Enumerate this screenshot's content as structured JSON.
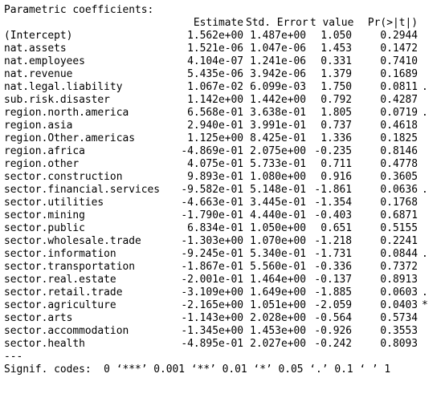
{
  "title": "Parametric coefficients:",
  "columns": {
    "estimate": "Estimate",
    "std_error": "Std. Error",
    "t_value": "t value",
    "p_value": "Pr(>|t|)"
  },
  "rows": [
    {
      "name": "(Intercept)",
      "estimate": "1.562e+00",
      "std_error": "1.487e+00",
      "t_value": "1.050",
      "p_value": "0.2944",
      "signif": ""
    },
    {
      "name": "nat.assets",
      "estimate": "1.521e-06",
      "std_error": "1.047e-06",
      "t_value": "1.453",
      "p_value": "0.1472",
      "signif": ""
    },
    {
      "name": "nat.employees",
      "estimate": "4.104e-07",
      "std_error": "1.241e-06",
      "t_value": "0.331",
      "p_value": "0.7410",
      "signif": ""
    },
    {
      "name": "nat.revenue",
      "estimate": "5.435e-06",
      "std_error": "3.942e-06",
      "t_value": "1.379",
      "p_value": "0.1689",
      "signif": ""
    },
    {
      "name": "nat.legal.liability",
      "estimate": "1.067e-02",
      "std_error": "6.099e-03",
      "t_value": "1.750",
      "p_value": "0.0811",
      "signif": "."
    },
    {
      "name": "sub.risk.disaster",
      "estimate": "1.142e+00",
      "std_error": "1.442e+00",
      "t_value": "0.792",
      "p_value": "0.4287",
      "signif": ""
    },
    {
      "name": "region.north.america",
      "estimate": "6.568e-01",
      "std_error": "3.638e-01",
      "t_value": "1.805",
      "p_value": "0.0719",
      "signif": "."
    },
    {
      "name": "region.asia",
      "estimate": "2.940e-01",
      "std_error": "3.991e-01",
      "t_value": "0.737",
      "p_value": "0.4618",
      "signif": ""
    },
    {
      "name": "region.Other.americas",
      "estimate": "1.125e+00",
      "std_error": "8.425e-01",
      "t_value": "1.336",
      "p_value": "0.1825",
      "signif": ""
    },
    {
      "name": "region.africa",
      "estimate": "-4.869e-01",
      "std_error": "2.075e+00",
      "t_value": "-0.235",
      "p_value": "0.8146",
      "signif": ""
    },
    {
      "name": "region.other",
      "estimate": "4.075e-01",
      "std_error": "5.733e-01",
      "t_value": "0.711",
      "p_value": "0.4778",
      "signif": ""
    },
    {
      "name": "sector.construction",
      "estimate": "9.893e-01",
      "std_error": "1.080e+00",
      "t_value": "0.916",
      "p_value": "0.3605",
      "signif": ""
    },
    {
      "name": "sector.financial.services",
      "estimate": "-9.582e-01",
      "std_error": "5.148e-01",
      "t_value": "-1.861",
      "p_value": "0.0636",
      "signif": "."
    },
    {
      "name": "sector.utilities",
      "estimate": "-4.663e-01",
      "std_error": "3.445e-01",
      "t_value": "-1.354",
      "p_value": "0.1768",
      "signif": ""
    },
    {
      "name": "sector.mining",
      "estimate": "-1.790e-01",
      "std_error": "4.440e-01",
      "t_value": "-0.403",
      "p_value": "0.6871",
      "signif": ""
    },
    {
      "name": "sector.public",
      "estimate": "6.834e-01",
      "std_error": "1.050e+00",
      "t_value": "0.651",
      "p_value": "0.5155",
      "signif": ""
    },
    {
      "name": "sector.wholesale.trade",
      "estimate": "-1.303e+00",
      "std_error": "1.070e+00",
      "t_value": "-1.218",
      "p_value": "0.2241",
      "signif": ""
    },
    {
      "name": "sector.information",
      "estimate": "-9.245e-01",
      "std_error": "5.340e-01",
      "t_value": "-1.731",
      "p_value": "0.0844",
      "signif": "."
    },
    {
      "name": "sector.transportation",
      "estimate": "-1.867e-01",
      "std_error": "5.560e-01",
      "t_value": "-0.336",
      "p_value": "0.7372",
      "signif": ""
    },
    {
      "name": "sector.real.estate",
      "estimate": "-2.001e-01",
      "std_error": "1.464e+00",
      "t_value": "-0.137",
      "p_value": "0.8913",
      "signif": ""
    },
    {
      "name": "sector.retail.trade",
      "estimate": "-3.109e+00",
      "std_error": "1.649e+00",
      "t_value": "-1.885",
      "p_value": "0.0603",
      "signif": "."
    },
    {
      "name": "sector.agriculture",
      "estimate": "-2.165e+00",
      "std_error": "1.051e+00",
      "t_value": "-2.059",
      "p_value": "0.0403",
      "signif": "*"
    },
    {
      "name": "sector.arts",
      "estimate": "-1.143e+00",
      "std_error": "2.028e+00",
      "t_value": "-0.564",
      "p_value": "0.5734",
      "signif": ""
    },
    {
      "name": "sector.accommodation",
      "estimate": "-1.345e+00",
      "std_error": "1.453e+00",
      "t_value": "-0.926",
      "p_value": "0.3553",
      "signif": ""
    },
    {
      "name": "sector.health",
      "estimate": "-4.895e-01",
      "std_error": "2.027e+00",
      "t_value": "-0.242",
      "p_value": "0.8093",
      "signif": ""
    }
  ],
  "separator": "---",
  "signif_codes": "Signif. codes:  0 ‘***’ 0.001 ‘**’ 0.01 ‘*’ 0.05 ‘.’ 0.1 ‘ ’ 1"
}
